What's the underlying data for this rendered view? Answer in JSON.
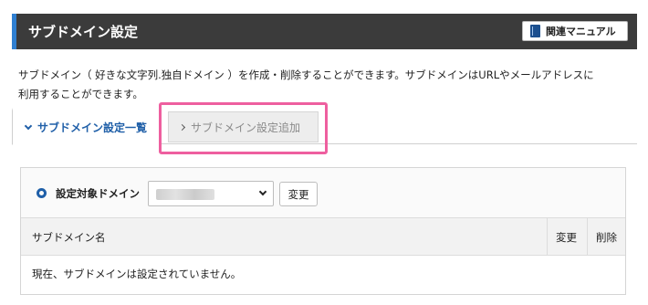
{
  "header": {
    "title": "サブドメイン設定",
    "manual_button": "関連マニュアル",
    "accent_color": "#2f7fd1",
    "bg_color": "#3b3b3b"
  },
  "description": {
    "line1": "サブドメイン（ 好きな文字列.独自ドメイン ）を作成・削除することができます。サブドメインはURLやメールアドレスに",
    "line2": "利用することができます。"
  },
  "tabs": [
    {
      "label": "サブドメイン設定一覧",
      "active": true
    },
    {
      "label": "サブドメイン設定追加",
      "active": false
    }
  ],
  "highlight_color": "#ee5f9f",
  "domain_selector": {
    "label": "設定対象ドメイン",
    "change_button": "変更"
  },
  "table": {
    "columns": [
      "サブドメイン名",
      "変更",
      "削除"
    ],
    "empty_message": "現在、サブドメインは設定されていません。"
  }
}
